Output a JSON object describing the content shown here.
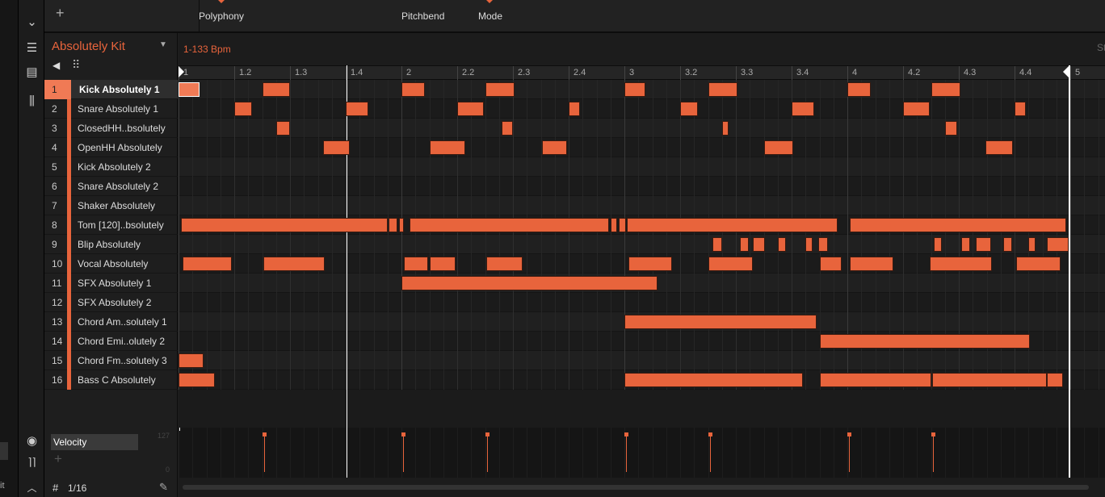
{
  "top": {
    "params": [
      {
        "label": "Polyphony"
      },
      {
        "label": "Pitchbend"
      },
      {
        "label": "Mode"
      }
    ],
    "add": "+"
  },
  "left_strip": {
    "text": "it"
  },
  "kit": {
    "name": "Absolutely Kit"
  },
  "header": {
    "tempo": "1-133 Bpm",
    "right_text": "St"
  },
  "ruler": {
    "ticks": [
      "1",
      "1.2",
      "1.3",
      "1.4",
      "2",
      "2.2",
      "2.3",
      "2.4",
      "3",
      "3.2",
      "3.3",
      "3.4",
      "4",
      "4.2",
      "4.3",
      "4.4",
      "5"
    ]
  },
  "accent": "#e8643c",
  "grid": {
    "steps_per_beat": 4,
    "beats_per_bar": 4,
    "bars": 4,
    "playhead_beat": 3
  },
  "tracks": [
    {
      "num": "1",
      "name": "Kick Absolutely 1",
      "selected": true,
      "notes": [
        [
          0,
          1.5
        ],
        [
          6,
          2
        ],
        [
          16,
          1.7
        ],
        [
          22,
          2.1
        ],
        [
          32,
          1.5
        ],
        [
          38,
          2.1
        ],
        [
          48,
          1.7
        ],
        [
          54,
          2.1
        ]
      ]
    },
    {
      "num": "2",
      "name": "Snare Absolutely 1",
      "notes": [
        [
          4,
          1.3
        ],
        [
          12,
          1.6
        ],
        [
          20,
          1.9
        ],
        [
          28,
          0.8
        ],
        [
          36,
          1.3
        ],
        [
          44,
          1.6
        ],
        [
          52,
          1.9
        ],
        [
          60,
          0.8
        ]
      ]
    },
    {
      "num": "3",
      "name": "ClosedHH..bsolutely",
      "notes": [
        [
          7,
          1
        ],
        [
          23.2,
          0.8
        ],
        [
          39,
          0.5
        ],
        [
          55,
          0.9
        ]
      ]
    },
    {
      "num": "4",
      "name": "OpenHH Absolutely",
      "notes": [
        [
          10.4,
          1.9
        ],
        [
          18,
          2.6
        ],
        [
          26.1,
          1.8
        ],
        [
          42,
          2.1
        ],
        [
          57.9,
          2
        ]
      ]
    },
    {
      "num": "5",
      "name": "Kick Absolutely 2",
      "notes": []
    },
    {
      "num": "6",
      "name": "Snare Absolutely 2",
      "notes": []
    },
    {
      "num": "7",
      "name": "Shaker Absolutely",
      "notes": []
    },
    {
      "num": "8",
      "name": "Tom [120]..bsolutely",
      "notes": [
        [
          0.2,
          14.8
        ],
        [
          15.1,
          0.6
        ],
        [
          15.8,
          0.4
        ],
        [
          16.6,
          14.3
        ],
        [
          31,
          0.5
        ],
        [
          31.6,
          0.5
        ],
        [
          32.2,
          15.1
        ],
        [
          48.2,
          15.5
        ]
      ]
    },
    {
      "num": "9",
      "name": "Blip Absolutely",
      "notes": [
        [
          38.3,
          0.7
        ],
        [
          40.3,
          0.6
        ],
        [
          41.2,
          0.9
        ],
        [
          43,
          0.6
        ],
        [
          45,
          0.5
        ],
        [
          45.9,
          0.7
        ],
        [
          54.2,
          0.6
        ],
        [
          56.2,
          0.6
        ],
        [
          57.2,
          1.1
        ],
        [
          59.2,
          0.6
        ],
        [
          61,
          0.5
        ],
        [
          62.3,
          1.6
        ]
      ]
    },
    {
      "num": "10",
      "name": "Vocal Absolutely",
      "notes": [
        [
          0.3,
          3.5
        ],
        [
          6.1,
          4.4
        ],
        [
          16.2,
          1.7
        ],
        [
          18,
          1.9
        ],
        [
          22.1,
          2.6
        ],
        [
          32.3,
          3.1
        ],
        [
          38,
          3.2
        ],
        [
          46,
          1.6
        ],
        [
          48.2,
          3.1
        ],
        [
          53.9,
          4.5
        ],
        [
          60.1,
          3.2
        ]
      ]
    },
    {
      "num": "11",
      "name": "SFX Absolutely 1",
      "notes": [
        [
          16,
          18.4
        ]
      ]
    },
    {
      "num": "12",
      "name": "SFX Absolutely 2",
      "notes": []
    },
    {
      "num": "13",
      "name": "Chord Am..solutely 1",
      "notes": [
        [
          32,
          13.8
        ]
      ]
    },
    {
      "num": "14",
      "name": "Chord Emi..olutely 2",
      "notes": [
        [
          46,
          15.1
        ]
      ]
    },
    {
      "num": "15",
      "name": "Chord Fm..solutely 3",
      "notes": [
        [
          0,
          1.8
        ]
      ]
    },
    {
      "num": "16",
      "name": "Bass C Absolutely",
      "notes": [
        [
          0,
          2.6
        ],
        [
          32,
          12.8
        ],
        [
          46,
          8
        ],
        [
          54.1,
          8.2
        ],
        [
          62.3,
          1.2
        ]
      ]
    }
  ],
  "lane": {
    "label": "Velocity",
    "add": "+",
    "max": "127",
    "min": "0",
    "velocities": [
      [
        6,
        127
      ],
      [
        16,
        127
      ],
      [
        22,
        127
      ],
      [
        32,
        127
      ],
      [
        38,
        127
      ],
      [
        48,
        127
      ],
      [
        54,
        127
      ]
    ]
  },
  "footer": {
    "grid_label": "1/16"
  }
}
